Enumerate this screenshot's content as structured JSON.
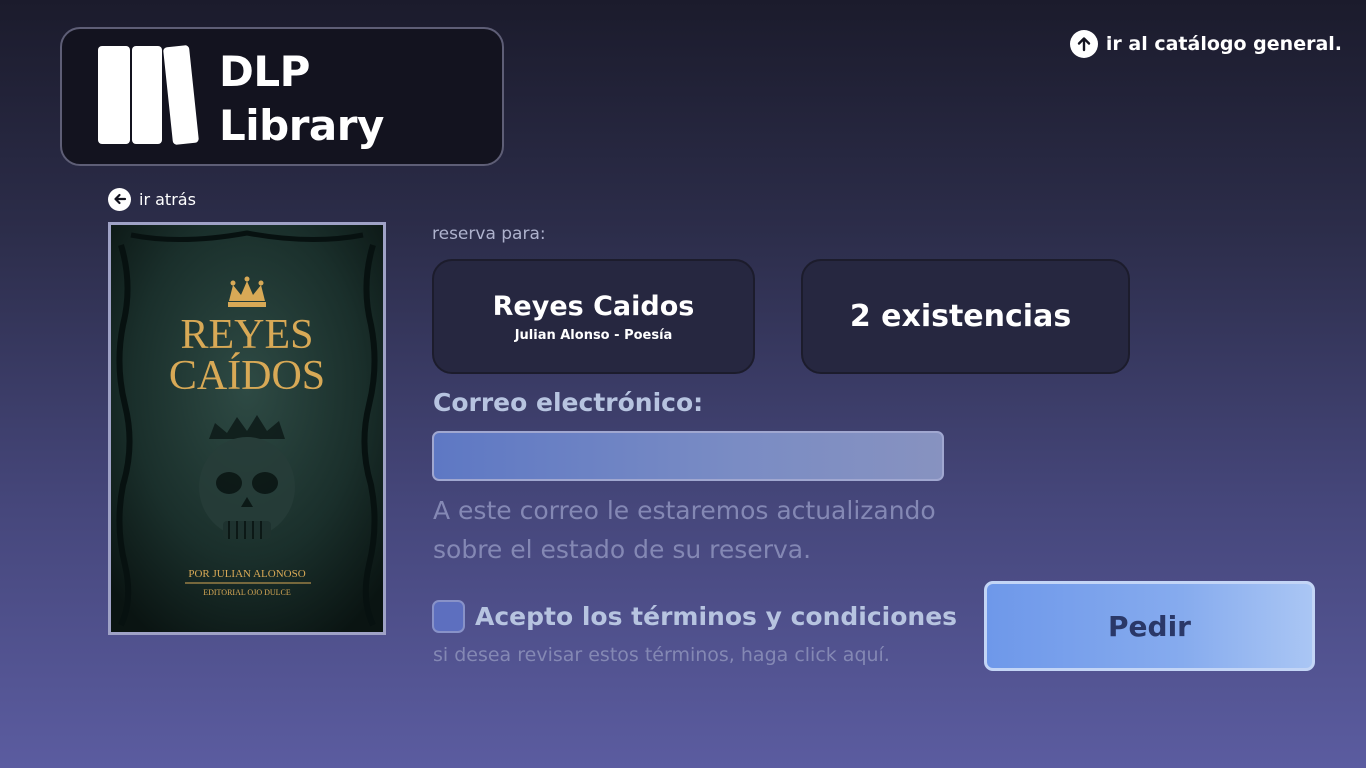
{
  "brand": {
    "line1": "DLP",
    "line2": "Library"
  },
  "nav": {
    "catalog_link": "ir al catálogo general.",
    "back_link": "ir atrás"
  },
  "cover": {
    "title_line1": "REYES",
    "title_line2": "CAÍDOS",
    "author_line": "POR JULIAN ALONOSO",
    "publisher_line": "EDITORIAL OJO DULCE"
  },
  "reservation": {
    "label": "reserva para:",
    "book_title": "Reyes Caidos",
    "book_subtitle": "Julian Alonso - Poesía",
    "stock": "2 existencias"
  },
  "form": {
    "email_label": "Correo electrónico:",
    "email_value": "",
    "email_placeholder": "",
    "email_help": "A este correo le estaremos actualizando sobre el estado de su reserva.",
    "terms_checked": false,
    "terms_label": "Acepto los términos y condiciones",
    "terms_link": "si desea revisar estos términos, haga click aquí.",
    "submit_label": "Pedir"
  },
  "colors": {
    "accent": "#7a9ff0",
    "card_bg": "#262740",
    "logo_bg": "#13131f",
    "cover_gold": "#d8a956"
  },
  "icons": {
    "catalog": "arrow-up-circle-icon",
    "back": "arrow-left-circle-icon",
    "logo": "books-icon"
  }
}
